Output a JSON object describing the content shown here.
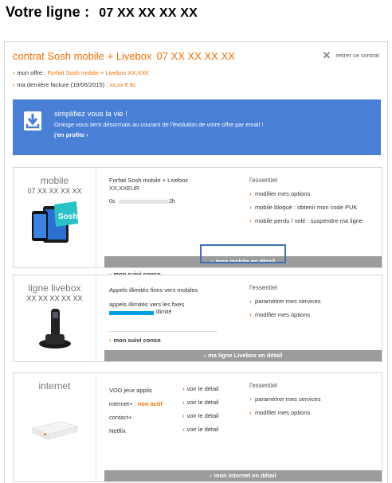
{
  "page": {
    "title": "Votre ligne :",
    "number": "07 XX XX XX XX"
  },
  "contract": {
    "title": "contrat Sosh mobile + Livebox",
    "number": "07 XX XX XX XX",
    "remove_label": "retirer ce contrat",
    "offer_label": "mon offre :",
    "offer_value": "Forfait Sosh mobile + Livebox XX,XX€",
    "invoice_label": "ma dernière facture (19/06/2015) :",
    "invoice_value": "xx,xx € ttc"
  },
  "banner": {
    "title": "simplifiez vous la vie !",
    "text": "Orange vous tient désormais au courant de l'évolution de votre offre par email !",
    "link": "j'en profite ›"
  },
  "mobile": {
    "name": "mobile",
    "number": "07 XX XX XX XX",
    "plan": "Forfait Sosh mobile + Livebox",
    "price": "XX,XXEUR",
    "gauge_start": "0s",
    "gauge_end": "2h",
    "gauge_fraction": 0.0,
    "suivi": "mon suivi conso",
    "essentiel": "l'essentiel",
    "links": [
      "modifier mes options",
      "mobile bloqué : obtenir mon code PUK",
      "mobile perdu / volé : suspendre ma ligne"
    ],
    "detail": "mon mobile en détail",
    "sticker": "Sosh"
  },
  "livebox": {
    "name": "ligne livebox",
    "number": "XX XX XX XX XX",
    "line1": "Appels illimités fixes vers mobiles",
    "line2": "appels illimités vers les fixes",
    "gauge_label": "illimité",
    "gauge_fraction": 1.0,
    "suivi": "mon suivi conso",
    "essentiel": "l'essentiel",
    "links": [
      "paramétrer mes services",
      "modifier mes options"
    ],
    "detail": "ma ligne Livebox en détail"
  },
  "internet": {
    "name": "internet",
    "rows": [
      {
        "label": "VOD jeux applis",
        "status": "",
        "link": "voir le détail"
      },
      {
        "label": "internet+ :",
        "status": "non actif",
        "link": "voir le détail"
      },
      {
        "label": "contact+",
        "status": "",
        "link": "voir le détail"
      },
      {
        "label": "Netflix",
        "status": "",
        "link": "voir le détail"
      }
    ],
    "essentiel": "l'essentiel",
    "links": [
      "paramétrer mes services",
      "modifier mes options"
    ],
    "detail": "mon internet en détail"
  },
  "colors": {
    "accent": "#f16e00",
    "banner": "#4a7fd6",
    "gauge": "#009ee0",
    "bar": "#9c9c9c",
    "highlight": "#3d6fb3"
  }
}
